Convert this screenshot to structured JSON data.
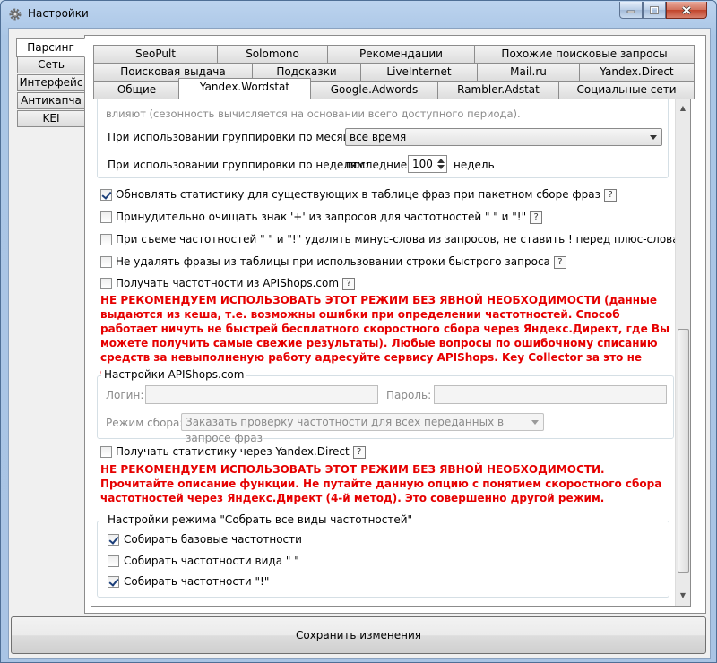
{
  "window": {
    "title": "Настройки"
  },
  "left_tabs": [
    "Парсинг",
    "Сеть",
    "Интерфейс",
    "Антикапча",
    "KEI"
  ],
  "top_tabs": {
    "row1": [
      "SeoPult",
      "Solomono",
      "Рекомендации",
      "Похожие поисковые запросы"
    ],
    "row2": [
      "Поисковая выдача",
      "Подсказки",
      "LiveInternet",
      "Mail.ru",
      "Yandex.Direct"
    ],
    "row3": [
      "Общие",
      "Yandex.Wordstat",
      "Google.Adwords",
      "Rambler.Adstat",
      "Социальные сети"
    ]
  },
  "active_left_tab": "Парсинг",
  "active_top_tab": "Yandex.Wordstat",
  "content": {
    "cut_text": "влияют (сезонность вычисляется на основании всего доступного периода).",
    "month_grouping": {
      "label": "При использовании группировки по месяцам:",
      "value": "все время"
    },
    "week_grouping": {
      "label": "При использовании группировки по неделям:",
      "prefix": "последние",
      "value": "100",
      "suffix": "недель"
    },
    "checkboxes": [
      {
        "label": "Обновлять статистику для существующих в таблице фраз при пакетном сборе фраз",
        "checked": true,
        "help": "?"
      },
      {
        "label": "Принудительно очищать знак '+' из запросов для частотностей \" \" и \"!\"",
        "checked": false,
        "help": "?"
      },
      {
        "label": "При съеме частотностей \" \" и \"!\" удалять минус-слова из запросов, не ставить ! перед плюс-словами, заменять !!",
        "checked": false
      },
      {
        "label": "Не удалять фразы из таблицы при использовании строки быстрого запроса",
        "checked": false,
        "help": "?"
      },
      {
        "label": "Получать частотности из APIShops.com",
        "checked": false,
        "help": "?"
      }
    ],
    "warning1": "НЕ РЕКОМЕНДУЕМ ИСПОЛЬЗОВАТЬ ЭТОТ РЕЖИМ БЕЗ ЯВНОЙ НЕОБХОДИМОСТИ (данные выдаются из кеша, т.е. возможны ошибки при определении частотностей. Способ работает ничуть не быстрей бесплатного скоростного сбора через Яндекс.Директ, где Вы можете получить самые свежие результаты). Любые вопросы по ошибочному списанию средств за невыполненую работу адресуйте сервису APIShops. Key Collector за это не отвечает.",
    "apishops": {
      "title": "Настройки APIShops.com",
      "login_label": "Логин:",
      "login_value": "",
      "password_label": "Пароль:",
      "password_value": "",
      "mode_label": "Режим сбора:",
      "mode_value": "Заказать проверку частотности для всех переданных в запросе фраз"
    },
    "direct_checkbox": {
      "label": "Получать статистику через Yandex.Direct",
      "checked": false,
      "help": "?"
    },
    "warning2": "НЕ РЕКОМЕНДУЕМ ИСПОЛЬЗОВАТЬ ЭТОТ РЕЖИМ БЕЗ ЯВНОЙ НЕОБХОДИМОСТИ. Прочитайте описание функции. Не путайте данную опцию с понятием скоростного сбора частотностей через Яндекс.Директ (4-й метод). Это совершенно другой режим.",
    "collect_all": {
      "title": "Настройки режима \"Собрать все виды частотностей\"",
      "items": [
        {
          "label": "Собирать базовые частотности",
          "checked": true
        },
        {
          "label": "Собирать частотности вида \" \"",
          "checked": false
        },
        {
          "label": "Собирать частотности \"!\"",
          "checked": true
        }
      ]
    }
  },
  "save_button": "Сохранить изменения",
  "colors": {
    "warning": "#e60000",
    "window_frame": "#a9c4e4"
  }
}
